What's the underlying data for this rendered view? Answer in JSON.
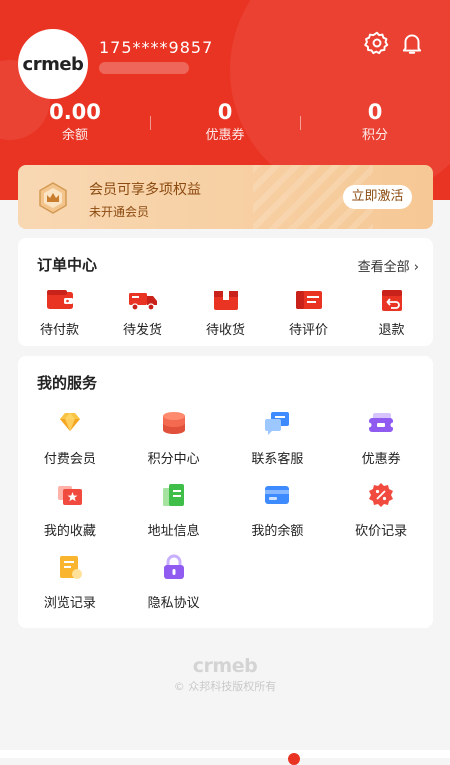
{
  "profile": {
    "logo_text": "crmeb",
    "phone": "175****9857"
  },
  "stats": [
    {
      "value": "0.00",
      "label": "余额"
    },
    {
      "value": "0",
      "label": "优惠券"
    },
    {
      "value": "0",
      "label": "积分"
    }
  ],
  "vip": {
    "title": "会员可享多项权益",
    "subtitle": "未开通会员",
    "button": "立即激活"
  },
  "orders": {
    "title": "订单中心",
    "view_all": "查看全部 ›",
    "items": [
      {
        "label": "待付款",
        "icon": "wallet-icon"
      },
      {
        "label": "待发货",
        "icon": "truck-icon"
      },
      {
        "label": "待收货",
        "icon": "package-icon"
      },
      {
        "label": "待评价",
        "icon": "review-icon"
      },
      {
        "label": "退款",
        "icon": "refund-icon"
      }
    ]
  },
  "services": {
    "title": "我的服务",
    "items": [
      {
        "label": "付费会员",
        "icon": "diamond-icon"
      },
      {
        "label": "积分中心",
        "icon": "coins-icon"
      },
      {
        "label": "联系客服",
        "icon": "chat-icon"
      },
      {
        "label": "优惠券",
        "icon": "coupon-icon"
      },
      {
        "label": "我的收藏",
        "icon": "star-icon"
      },
      {
        "label": "地址信息",
        "icon": "address-icon"
      },
      {
        "label": "我的余额",
        "icon": "card-icon"
      },
      {
        "label": "砍价记录",
        "icon": "bargain-icon"
      },
      {
        "label": "浏览记录",
        "icon": "history-icon"
      },
      {
        "label": "隐私协议",
        "icon": "lock-icon"
      }
    ]
  },
  "footer": {
    "logo_text": "crmeb",
    "copyright": "© 众邦科技版权所有"
  },
  "colors": {
    "primary": "#e93323",
    "vip_text": "#8b4a10",
    "background": "#f5f5f5"
  }
}
